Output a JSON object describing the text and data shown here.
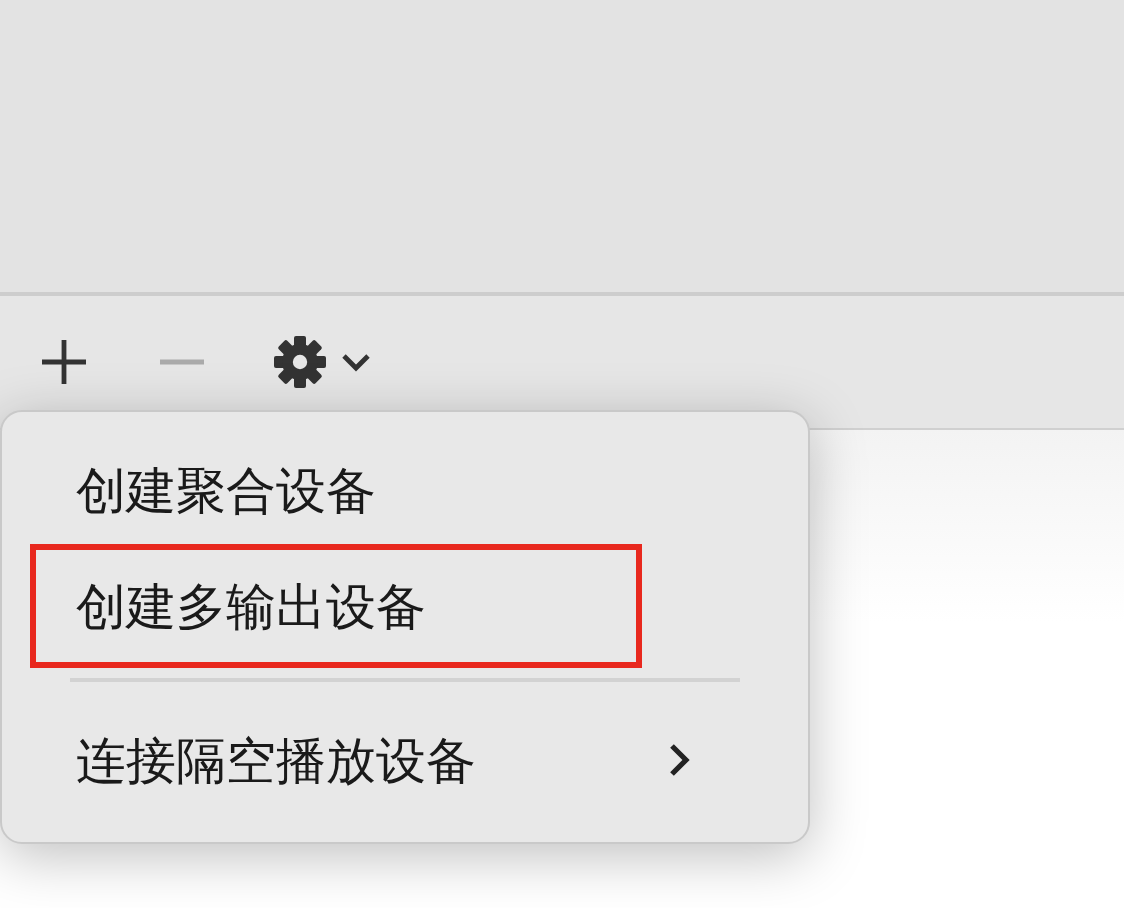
{
  "toolbar": {
    "buttons": [
      {
        "kind": "add",
        "disabled": false
      },
      {
        "kind": "remove",
        "disabled": true
      },
      {
        "kind": "gear-menu",
        "disabled": false
      }
    ]
  },
  "menu": {
    "items": [
      {
        "kind": "item",
        "label": "创建聚合设备",
        "submenu": false,
        "annotated": false
      },
      {
        "kind": "item",
        "label": "创建多输出设备",
        "submenu": false,
        "annotated": true
      },
      {
        "kind": "separator"
      },
      {
        "kind": "item",
        "label": "连接隔空播放设备",
        "submenu": true,
        "annotated": false
      }
    ]
  }
}
